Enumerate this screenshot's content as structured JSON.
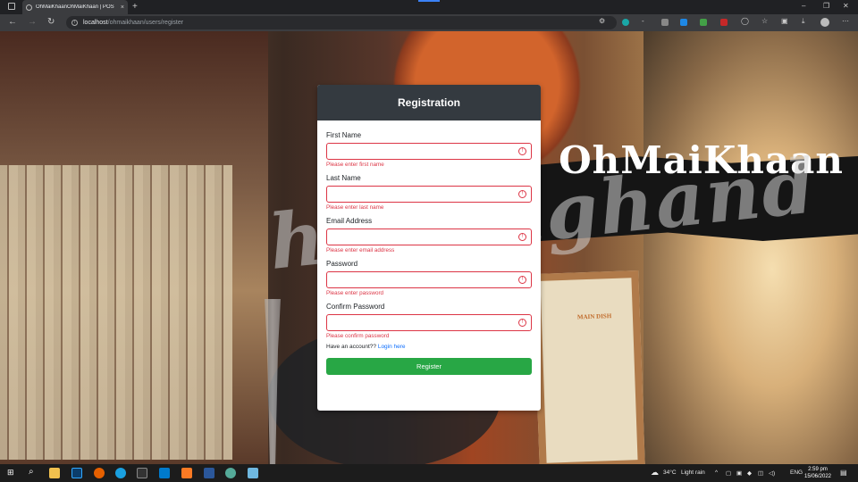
{
  "browser": {
    "tab_title": "OhMaiKhaanOhMaiKhaan | POS",
    "tab_close": "×",
    "new_tab": "+",
    "url_host": "localhost",
    "url_path": "/ohmaikhaan/users/register"
  },
  "window_controls": {
    "minimize": "–",
    "maximize": "❐",
    "close": "✕"
  },
  "background": {
    "brand_text": "OhMaiKhaan",
    "watermark_text": "helpinghand",
    "menu_heading": "MAIN DISH"
  },
  "form": {
    "title": "Registration",
    "fields": [
      {
        "label": "First Name",
        "value": "",
        "error": "Please enter first name"
      },
      {
        "label": "Last Name",
        "value": "",
        "error": "Please enter last name"
      },
      {
        "label": "Email Address",
        "value": "",
        "error": "Please enter email address"
      },
      {
        "label": "Password",
        "value": "",
        "error": "Please enter password"
      },
      {
        "label": "Confirm Password",
        "value": "",
        "error": "Please confirm password"
      }
    ],
    "login_prompt": "Have an account?? ",
    "login_link": "Login here",
    "submit_label": "Register"
  },
  "taskbar": {
    "weather_temp": "34°C",
    "weather_desc": "Light rain",
    "language": "ENG",
    "time": "2:59 pm",
    "date": "15/06/2022"
  },
  "colors": {
    "header_dark": "#343a40",
    "error_red": "#dc3545",
    "button_green": "#28a745",
    "link_blue": "#0d6efd"
  }
}
